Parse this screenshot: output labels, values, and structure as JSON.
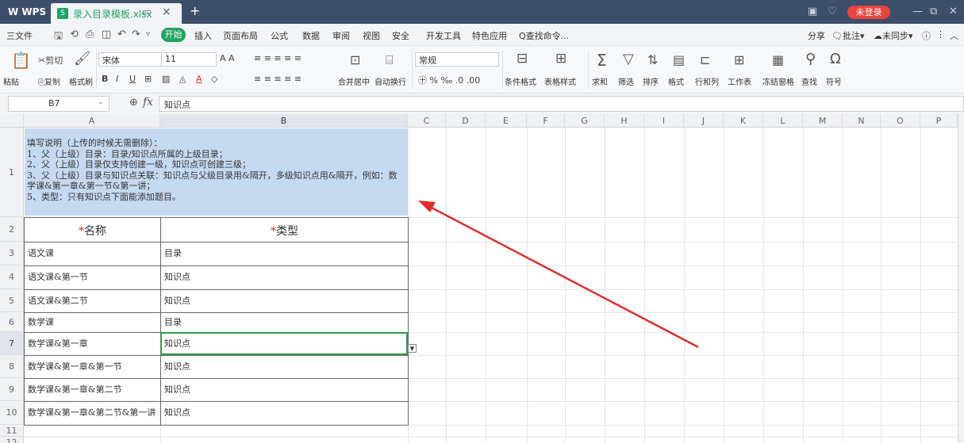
{
  "title_bar": {
    "app_name": "WPS",
    "file_name": "录入目录模板.xlsx",
    "login": "未登录"
  },
  "menu": {
    "file": "三文件",
    "items": [
      "开始",
      "插入",
      "页面布局",
      "公式",
      "数据",
      "审阅",
      "视图",
      "安全",
      "开发工具",
      "特色应用"
    ],
    "search": "Q查找命令...",
    "share": "分享",
    "comment": "批注",
    "sync": "未同步"
  },
  "ribbon": {
    "paste": "粘贴",
    "cut": "剪切",
    "copy": "复制",
    "format_painter": "格式刷",
    "font_name": "宋体",
    "font_size": "11",
    "merge_center": "合并居中",
    "wrap": "自动换行",
    "number_format": "常规",
    "cond_format": "条件格式",
    "table_style": "表格样式",
    "sum": "求和",
    "filter": "筛选",
    "sort": "排序",
    "format": "格式",
    "row_col": "行和列",
    "worksheet": "工作表",
    "freeze": "冻结窗格",
    "find": "查找",
    "symbol": "符号"
  },
  "formula_bar": {
    "cell_ref": "B7",
    "fx": "fx",
    "content": "知识点"
  },
  "columns": [
    "A",
    "B",
    "C",
    "D",
    "E",
    "F",
    "G",
    "H",
    "I",
    "J",
    "K",
    "L",
    "M",
    "N",
    "O",
    "P"
  ],
  "rows": [
    "1",
    "2",
    "3",
    "4",
    "5",
    "6",
    "7",
    "8",
    "9",
    "10",
    "11",
    "12"
  ],
  "instructions": [
    "填写说明（上传的时候无需删除）：",
    "1、父（上级）目录：目录/知识点所属的上级目录；",
    "2、父（上级）目录仅支持创建一级，知识点可创建三级；",
    "3、父（上级）目录与知识点关联：知识点与父级目录用&隔开，多级知识点用&隔开，例如：数",
    "学课&第一章&第一节&第一讲；",
    "5、类型：只有知识点下面能添加题目。"
  ],
  "table_header": {
    "required_mark": "*",
    "name": "名称",
    "type": "类型"
  },
  "table_rows": [
    {
      "name": "语文课",
      "type": "目录"
    },
    {
      "name": "语文课&第一节",
      "type": "知识点"
    },
    {
      "name": "语文课&第二节",
      "type": "知识点"
    },
    {
      "name": "数学课",
      "type": "目录"
    },
    {
      "name": "数学课&第一章",
      "type": "知识点"
    },
    {
      "name": "数学课&第一章&第一节",
      "type": "知识点"
    },
    {
      "name": "数学课&第一章&第二节",
      "type": "知识点"
    },
    {
      "name": "数学课&第一章&第二节&第一讲",
      "type": "知识点"
    }
  ],
  "colors": {
    "title_bg": "#3d4e6a",
    "accent": "#1fa463",
    "highlight": "#c5d9f1",
    "annotation_red": "#e02d2d",
    "selection_green": "#2e9e45"
  }
}
